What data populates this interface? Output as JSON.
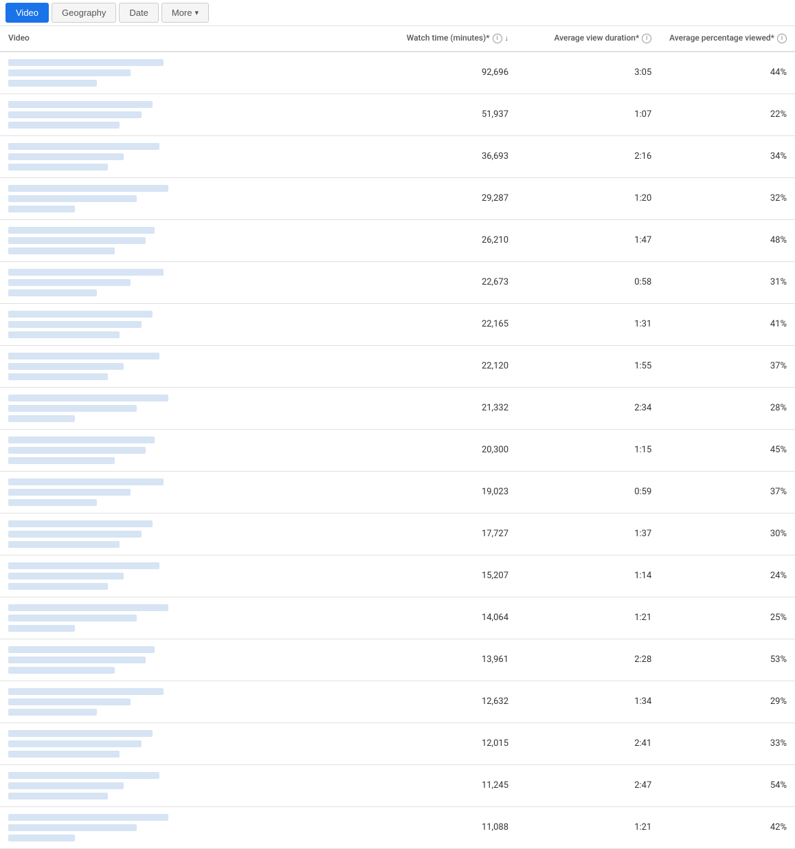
{
  "tabs": [
    {
      "label": "Video",
      "active": true
    },
    {
      "label": "Geography",
      "active": false
    },
    {
      "label": "Date",
      "active": false
    },
    {
      "label": "More",
      "active": false,
      "dropdown": true
    }
  ],
  "columns": {
    "video": "Video",
    "watchtime": "Watch time (minutes)*",
    "avgduration": "Average view duration*",
    "avgpct": "Average percentage viewed*"
  },
  "rows": [
    {
      "watchtime": "92,696",
      "avgduration": "3:05",
      "avgpct": "44%"
    },
    {
      "watchtime": "51,937",
      "avgduration": "1:07",
      "avgpct": "22%"
    },
    {
      "watchtime": "36,693",
      "avgduration": "2:16",
      "avgpct": "34%"
    },
    {
      "watchtime": "29,287",
      "avgduration": "1:20",
      "avgpct": "32%"
    },
    {
      "watchtime": "26,210",
      "avgduration": "1:47",
      "avgpct": "48%"
    },
    {
      "watchtime": "22,673",
      "avgduration": "0:58",
      "avgpct": "31%"
    },
    {
      "watchtime": "22,165",
      "avgduration": "1:31",
      "avgpct": "41%"
    },
    {
      "watchtime": "22,120",
      "avgduration": "1:55",
      "avgpct": "37%"
    },
    {
      "watchtime": "21,332",
      "avgduration": "2:34",
      "avgpct": "28%"
    },
    {
      "watchtime": "20,300",
      "avgduration": "1:15",
      "avgpct": "45%"
    },
    {
      "watchtime": "19,023",
      "avgduration": "0:59",
      "avgpct": "37%"
    },
    {
      "watchtime": "17,727",
      "avgduration": "1:37",
      "avgpct": "30%"
    },
    {
      "watchtime": "15,207",
      "avgduration": "1:14",
      "avgpct": "24%"
    },
    {
      "watchtime": "14,064",
      "avgduration": "1:21",
      "avgpct": "25%"
    },
    {
      "watchtime": "13,961",
      "avgduration": "2:28",
      "avgpct": "53%"
    },
    {
      "watchtime": "12,632",
      "avgduration": "1:34",
      "avgpct": "29%"
    },
    {
      "watchtime": "12,015",
      "avgduration": "2:41",
      "avgpct": "33%"
    },
    {
      "watchtime": "11,245",
      "avgduration": "2:47",
      "avgpct": "54%"
    },
    {
      "watchtime": "11,088",
      "avgduration": "1:21",
      "avgpct": "42%"
    }
  ],
  "placeholder_rows": [
    [
      70,
      55,
      40
    ],
    [
      65,
      60,
      50
    ],
    [
      68,
      52,
      45
    ],
    [
      72,
      58,
      30
    ],
    [
      66,
      62,
      48
    ],
    [
      70,
      55,
      40
    ],
    [
      65,
      60,
      50
    ],
    [
      68,
      52,
      45
    ],
    [
      72,
      58,
      30
    ],
    [
      66,
      62,
      48
    ],
    [
      70,
      55,
      40
    ],
    [
      65,
      60,
      50
    ],
    [
      68,
      52,
      45
    ],
    [
      72,
      58,
      30
    ],
    [
      66,
      62,
      48
    ],
    [
      70,
      55,
      40
    ],
    [
      65,
      60,
      50
    ],
    [
      68,
      52,
      45
    ],
    [
      72,
      58,
      30
    ]
  ]
}
